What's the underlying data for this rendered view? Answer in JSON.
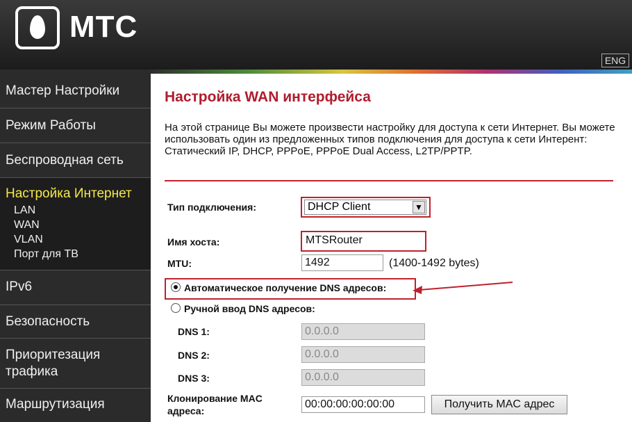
{
  "header": {
    "brand": "МТС",
    "lang_button": "ENG"
  },
  "sidebar": {
    "items": [
      {
        "label": "Мастер Настройки"
      },
      {
        "label": "Режим Работы"
      },
      {
        "label": "Беспроводная сеть"
      },
      {
        "label": "Настройка Интернет"
      },
      {
        "label": "IPv6"
      },
      {
        "label": "Безопасность"
      },
      {
        "label": "Приоритезация\nтрафика"
      },
      {
        "label": "Маршрутизация"
      }
    ],
    "subitems": [
      {
        "label": "LAN"
      },
      {
        "label": "WAN"
      },
      {
        "label": "VLAN"
      },
      {
        "label": "Порт для ТВ"
      }
    ]
  },
  "main": {
    "title": "Настройка WAN интерфейса",
    "description": "На этой странице Вы можете произвести настройку для доступа к сети Интернет. Вы можете использовать один из предложенных типов подключения для доступа к сети Интерент: Статический IP, DHCP, PPPoE, PPPoE Dual Access, L2TP/PPTP.",
    "connection_type_label": "Тип подключения:",
    "connection_type_value": "DHCP Client",
    "hostname_label": "Имя хоста:",
    "hostname_value": "MTSRouter",
    "mtu_label": "MTU:",
    "mtu_value": "1492",
    "mtu_hint": "(1400-1492 bytes)",
    "dns_auto_label": "Автоматическое получение DNS адресов:",
    "dns_manual_label": "Ручной ввод DNS адресов:",
    "dns1_label": "DNS 1:",
    "dns1_value": "0.0.0.0",
    "dns2_label": "DNS 2:",
    "dns2_value": "0.0.0.0",
    "dns3_label": "DNS 3:",
    "dns3_value": "0.0.0.0",
    "mac_clone_label_1": "Клонирование MAC",
    "mac_clone_label_2": "адреса:",
    "mac_value": "00:00:00:00:00:00",
    "get_mac_button": "Получить MAC адрес"
  },
  "colors": {
    "accent": "#c0202c",
    "sidebar_bg": "#2b2b2b",
    "active_text": "#f5e94a"
  }
}
